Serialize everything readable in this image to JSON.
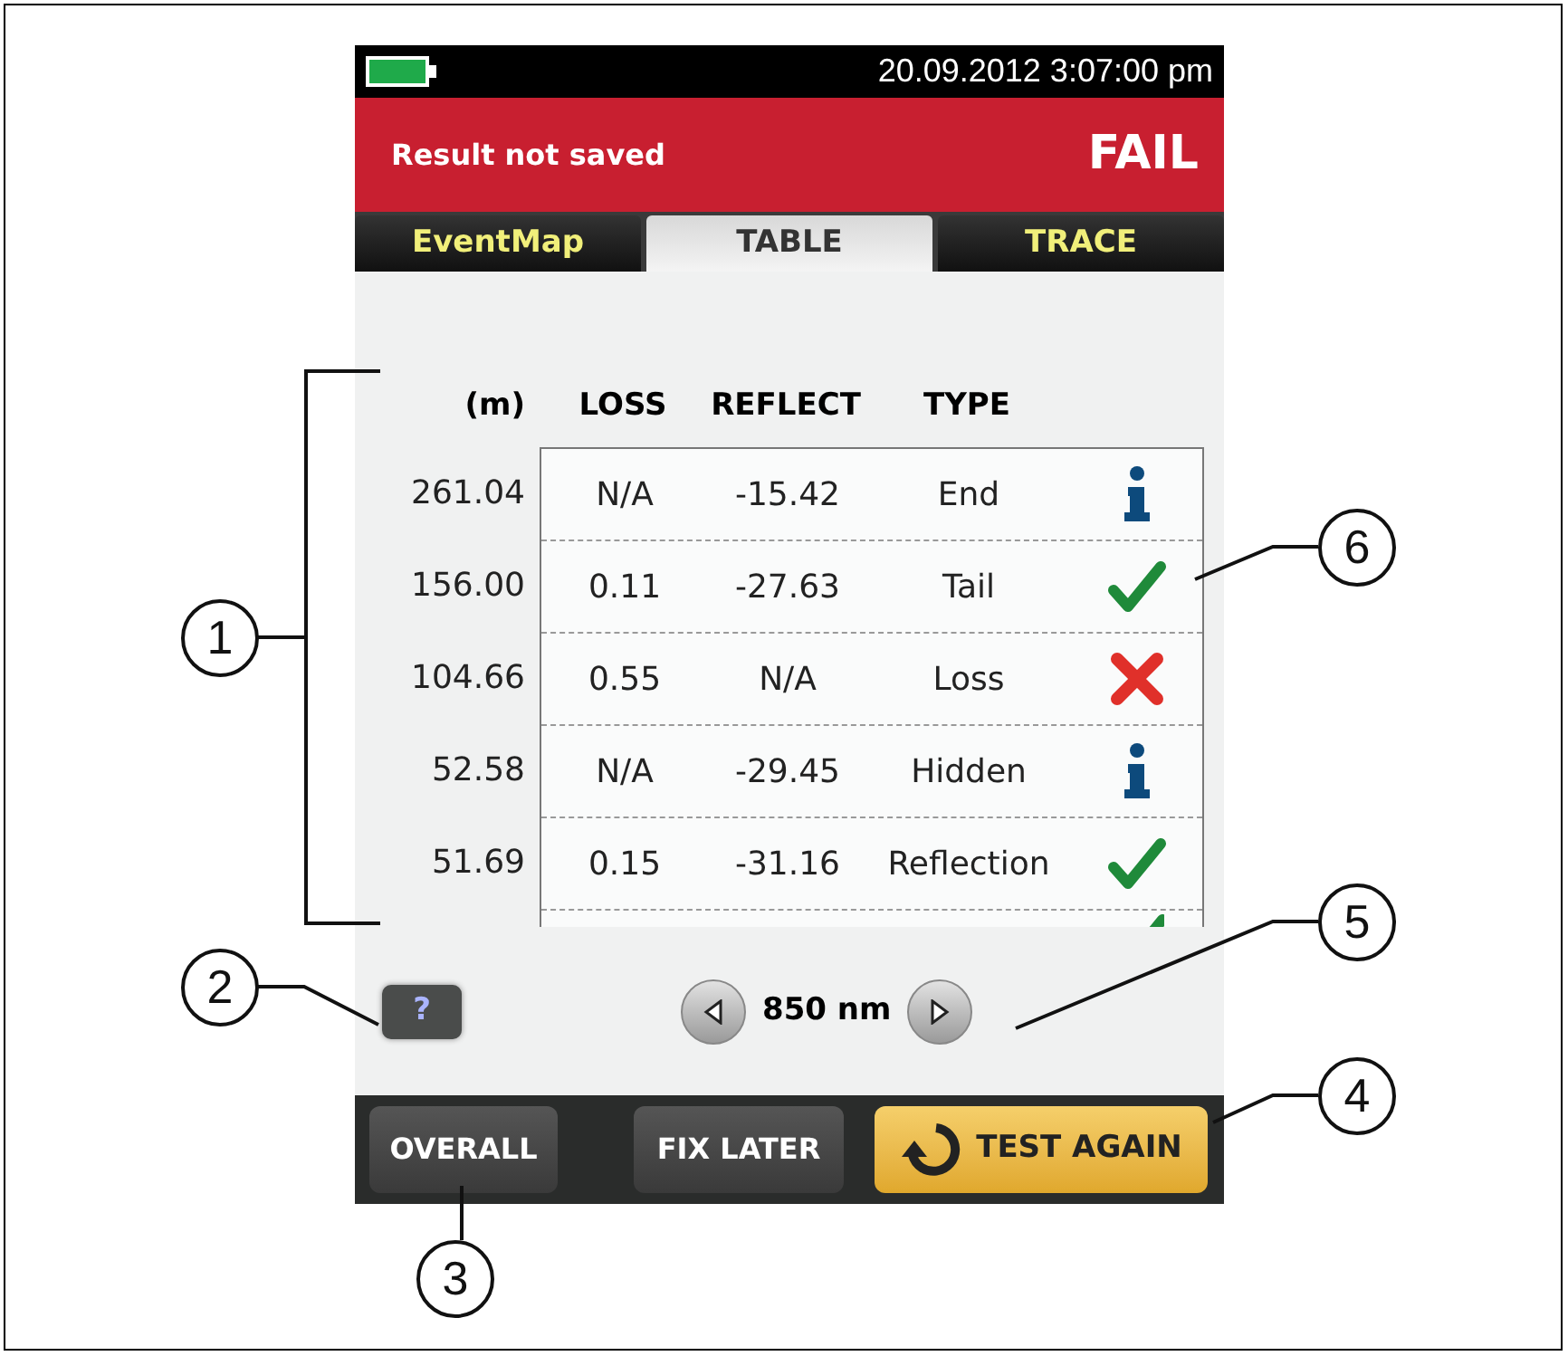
{
  "status_bar": {
    "datetime": "20.09.2012 3:07:00 pm"
  },
  "header": {
    "message": "Result not saved",
    "result": "FAIL"
  },
  "tabs": [
    {
      "label": "EventMap",
      "selected": false
    },
    {
      "label": "TABLE",
      "selected": true
    },
    {
      "label": "TRACE",
      "selected": false
    }
  ],
  "table": {
    "columns": [
      "(m)",
      "LOSS",
      "REFLECT",
      "TYPE"
    ],
    "rows": [
      {
        "distance": "261.04",
        "loss": "N/A",
        "reflect": "-15.42",
        "type": "End",
        "kind": "info"
      },
      {
        "distance": "156.00",
        "loss": "0.11",
        "reflect": "-27.63",
        "type": "Tail",
        "kind": "pass"
      },
      {
        "distance": "104.66",
        "loss": "0.55",
        "reflect": "N/A",
        "type": "Loss",
        "kind": "fail"
      },
      {
        "distance": "52.58",
        "loss": "N/A",
        "reflect": "-29.45",
        "type": "Hidden",
        "kind": "info"
      },
      {
        "distance": "51.69",
        "loss": "0.15",
        "reflect": "-31.16",
        "type": "Reflection",
        "kind": "pass"
      }
    ],
    "partial_row": {
      "kind": "pass"
    }
  },
  "help_button": {
    "label": "?"
  },
  "wavelength": {
    "label": "850 nm"
  },
  "buttons": [
    {
      "label": "OVERALL",
      "kind": "dark"
    },
    {
      "label": "FIX LATER",
      "kind": "dark"
    },
    {
      "label": "TEST AGAIN",
      "kind": "primary"
    }
  ],
  "callouts": [
    "6",
    "1",
    "5",
    "2",
    "4",
    "3"
  ]
}
